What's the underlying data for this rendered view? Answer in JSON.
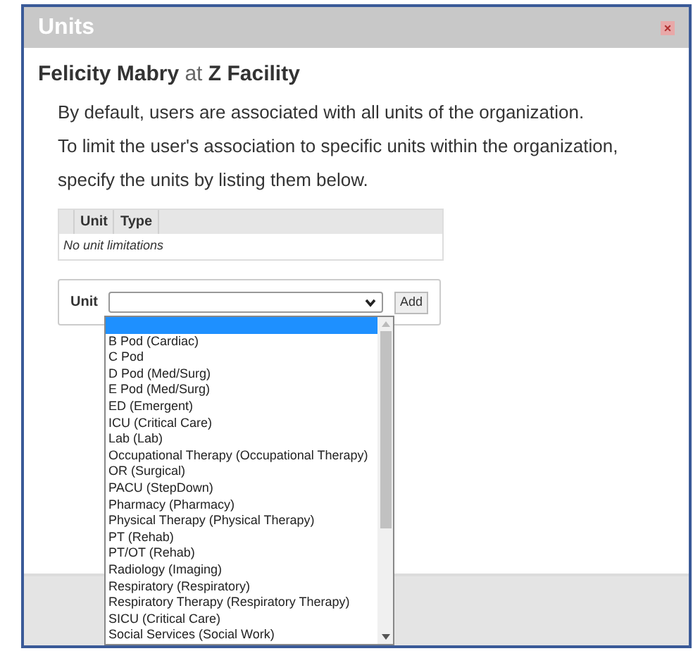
{
  "dialog": {
    "title": "Units",
    "close": "×"
  },
  "heading": "**Felicity Mabry** at **Z Facility**",
  "description": [
    "By default, users are associated with all units of the organization.",
    "To limit the user's association to specific units within the organization,",
    "specify the units by listing them below."
  ],
  "table": {
    "columns": [
      "Unit",
      "Type"
    ],
    "empty_message": "No unit limitations"
  },
  "unit_form": {
    "label": "Unit",
    "button": "Add",
    "dropdown": {
      "expanded": true,
      "options": [
        {
          "selected": true
        },
        {
          "label": "B Pod (Cardiac)",
          "selected": false
        },
        {
          "label": "C Pod",
          "selected": false
        },
        {
          "label": "D Pod (Med/Surg)",
          "selected": false
        },
        {
          "label": "E Pod (Med/Surg)",
          "selected": false
        },
        {
          "label": "ED (Emergent)",
          "selected": false
        },
        {
          "label": "ICU (Critical Care)",
          "selected": false
        },
        {
          "label": "Lab (Lab)",
          "selected": false
        },
        {
          "label": "Occupational Therapy (Occupational Therapy)",
          "selected": false
        },
        {
          "label": "OR (Surgical)",
          "selected": false
        },
        {
          "label": "PACU (StepDown)",
          "selected": false
        },
        {
          "label": "Pharmacy (Pharmacy)",
          "selected": false
        },
        {
          "label": "Physical Therapy (Physical Therapy)",
          "selected": false
        },
        {
          "label": "PT (Rehab)",
          "selected": false
        },
        {
          "label": "PT/OT (Rehab)",
          "selected": false
        },
        {
          "label": "Radiology (Imaging)",
          "selected": false
        },
        {
          "label": "Respiratory (Respiratory)",
          "selected": false
        },
        {
          "label": "Respiratory Therapy (Respiratory Therapy)",
          "selected": false
        },
        {
          "label": "SICU (Critical Care)",
          "selected": false
        },
        {
          "label": "Social Services (Social Work)",
          "selected": false
        }
      ]
    }
  }
}
